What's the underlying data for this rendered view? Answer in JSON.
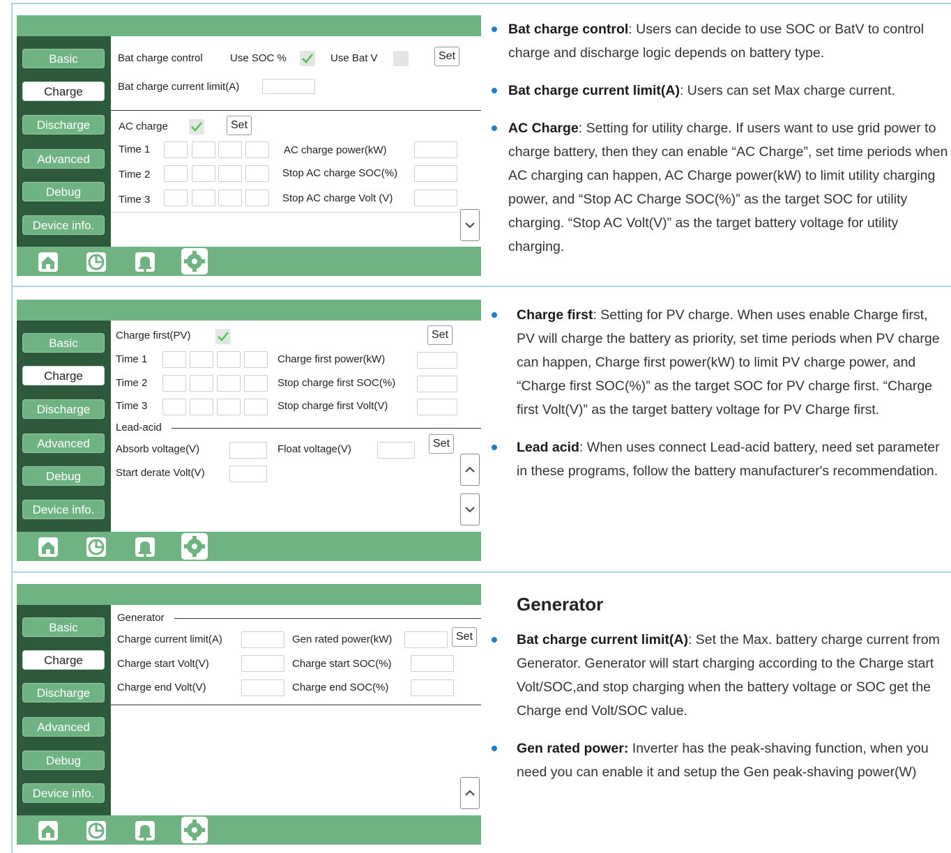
{
  "nav": {
    "basic": "Basic",
    "charge": "Charge",
    "discharge": "Discharge",
    "advanced": "Advanced",
    "debug": "Debug",
    "device_info": "Device info."
  },
  "screen1": {
    "bat_charge_control": "Bat charge control",
    "use_soc": "Use SOC %",
    "use_bat_v": "Use Bat V",
    "set": "Set",
    "bat_charge_current_limit": "Bat charge current limit(A)",
    "ac_charge": "AC charge",
    "time1": "Time  1",
    "time2": "Time  2",
    "time3": "Time  3",
    "ac_charge_power": "AC charge power(kW)",
    "stop_ac_charge_soc": "Stop AC charge SOC(%)",
    "stop_ac_charge_volt": "Stop AC charge Volt (V)"
  },
  "screen2": {
    "charge_first_pv": "Charge first(PV)",
    "set": "Set",
    "time1": "Time 1",
    "time2": "Time 2",
    "time3": "Time 3",
    "charge_first_power": "Charge first power(kW)",
    "stop_charge_first_soc": "Stop charge first SOC(%)",
    "stop_charge_first_volt": "Stop charge first Volt(V)",
    "lead_acid": "Lead-acid",
    "absorb_voltage": "Absorb voltage(V)",
    "float_voltage": "Float voltage(V)",
    "start_derate_volt": "Start derate Volt(V)"
  },
  "screen3": {
    "generator": "Generator",
    "charge_current_limit": "Charge current limit(A)",
    "gen_rated_power": "Gen rated power(kW)",
    "set": "Set",
    "charge_start_volt": "Charge start Volt(V)",
    "charge_start_soc": "Charge start SOC(%)",
    "charge_end_volt": "Charge end Volt(V)",
    "charge_end_soc": "Charge end SOC(%)"
  },
  "desc1": [
    {
      "term": "Bat charge control",
      "text": ": Users can decide to use SOC or BatV to control charge and discharge logic depends on battery type."
    },
    {
      "term": "Bat charge current limit(A)",
      "text": ": Users can set Max charge current."
    },
    {
      "term": "AC Charge",
      "text": ": Setting for utility charge. If users want to use grid power to charge battery, then they can enable “AC Charge”, set time periods when AC charging can happen, AC Charge power(kW) to limit utility charging power, and “Stop AC Charge SOC(%)” as the target SOC for utility charging. “Stop AC Volt(V)” as the target battery voltage for utility charging."
    }
  ],
  "desc2": [
    {
      "term": "Charge first",
      "text": ": Setting for PV charge. When uses enable Charge first, PV will charge the battery as priority, set time periods when PV charge can happen, Charge first power(kW) to limit PV charge power, and “Charge first SOC(%)” as the target SOC for PV charge first. “Charge first Volt(V)” as the target battery voltage for PV Charge first."
    },
    {
      "term": "Lead acid",
      "text": ": When uses connect Lead-acid battery, need set parameter in these programs, follow the battery manufacturer's recommendation."
    }
  ],
  "gen_title": "Generator",
  "desc3": [
    {
      "term": "Bat charge current limit(A)",
      "text": ": Set the Max. battery charge current from Generator. Generator will start charging according to the Charge start Volt/SOC,and stop charging when the battery voltage or SOC get the Charge end Volt/SOC value."
    },
    {
      "term": "Gen rated power:",
      "text": " Inverter has the peak-shaving function, when you need you can enable it and setup the Gen peak-shaving power(W)"
    }
  ],
  "colors": {
    "green_bar": "#6fb382",
    "sidebar": "#2c5a3b",
    "bullet": "#1f7fc6",
    "frame": "#a9d4e0"
  }
}
